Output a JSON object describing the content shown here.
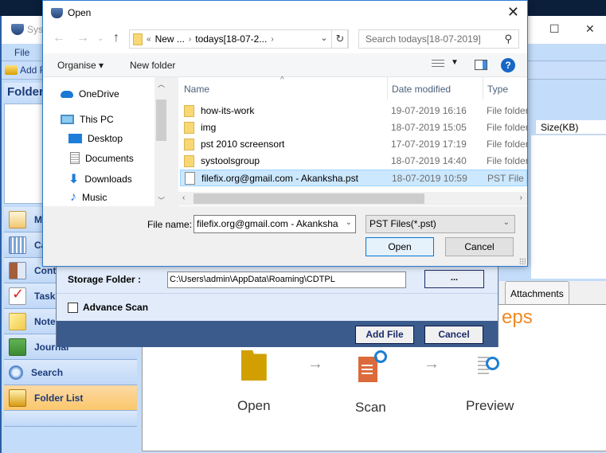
{
  "app": {
    "title": "SysT",
    "menu_file": "File",
    "toolbar_add": "Add F",
    "folders_header": "Folder",
    "list_column_size": "Size(KB)",
    "tab_attachments": "Attachments",
    "nav_items": [
      {
        "label": "Ma",
        "icon": "mail-icon"
      },
      {
        "label": "Ca",
        "icon": "calendar-icon"
      },
      {
        "label": "Conta",
        "icon": "contacts-icon"
      },
      {
        "label": "Tasks",
        "icon": "tasks-icon"
      },
      {
        "label": "Notes",
        "icon": "notes-icon"
      },
      {
        "label": "Journal",
        "icon": "journal-icon"
      },
      {
        "label": "Search",
        "icon": "search-icon"
      },
      {
        "label": "Folder List",
        "icon": "folder-list-icon",
        "active": true
      }
    ],
    "steps_title": "eps",
    "steps": [
      {
        "label": "Open"
      },
      {
        "label": "Scan"
      },
      {
        "label": "Preview"
      }
    ]
  },
  "add_file_panel": {
    "storage_label": "Storage Folder :",
    "storage_path": "C:\\Users\\admin\\AppData\\Roaming\\CDTPL",
    "browse_label": "...",
    "advance_scan_label": "Advance Scan",
    "advance_scan_checked": false,
    "add_file_label": "Add File",
    "cancel_label": "Cancel"
  },
  "dialog": {
    "title": "Open",
    "breadcrumb": {
      "prefix": "«",
      "parts": [
        "New ...",
        "todays[18-07-2..."
      ]
    },
    "search_placeholder": "Search todays[18-07-2019]",
    "organise_label": "Organise ▾",
    "new_folder_label": "New folder",
    "tree": [
      {
        "label": "OneDrive",
        "icon": "onedrive-icon"
      },
      {
        "label": "This PC",
        "icon": "this-pc-icon"
      },
      {
        "label": "Desktop",
        "icon": "desktop-icon"
      },
      {
        "label": "Documents",
        "icon": "documents-icon"
      },
      {
        "label": "Downloads",
        "icon": "downloads-icon"
      },
      {
        "label": "Music",
        "icon": "music-icon"
      }
    ],
    "columns": {
      "name": "Name",
      "date": "Date modified",
      "type": "Type"
    },
    "files": [
      {
        "name": "how-its-work",
        "date": "19-07-2019 16:16",
        "type": "File folder",
        "kind": "folder"
      },
      {
        "name": "img",
        "date": "18-07-2019 15:05",
        "type": "File folder",
        "kind": "folder"
      },
      {
        "name": "pst 2010 screensort",
        "date": "17-07-2019 17:19",
        "type": "File folder",
        "kind": "folder"
      },
      {
        "name": "systoolsgroup",
        "date": "18-07-2019 14:40",
        "type": "File folder",
        "kind": "folder"
      },
      {
        "name": "filefix.org@gmail.com - Akanksha.pst",
        "date": "18-07-2019 10:59",
        "type": "PST File",
        "kind": "file",
        "selected": true
      }
    ],
    "file_name_label": "File name:",
    "file_name_value": "filefix.org@gmail.com - Akanksha",
    "file_type_value": "PST Files(*.pst)",
    "open_label": "Open",
    "cancel_label": "Cancel"
  }
}
